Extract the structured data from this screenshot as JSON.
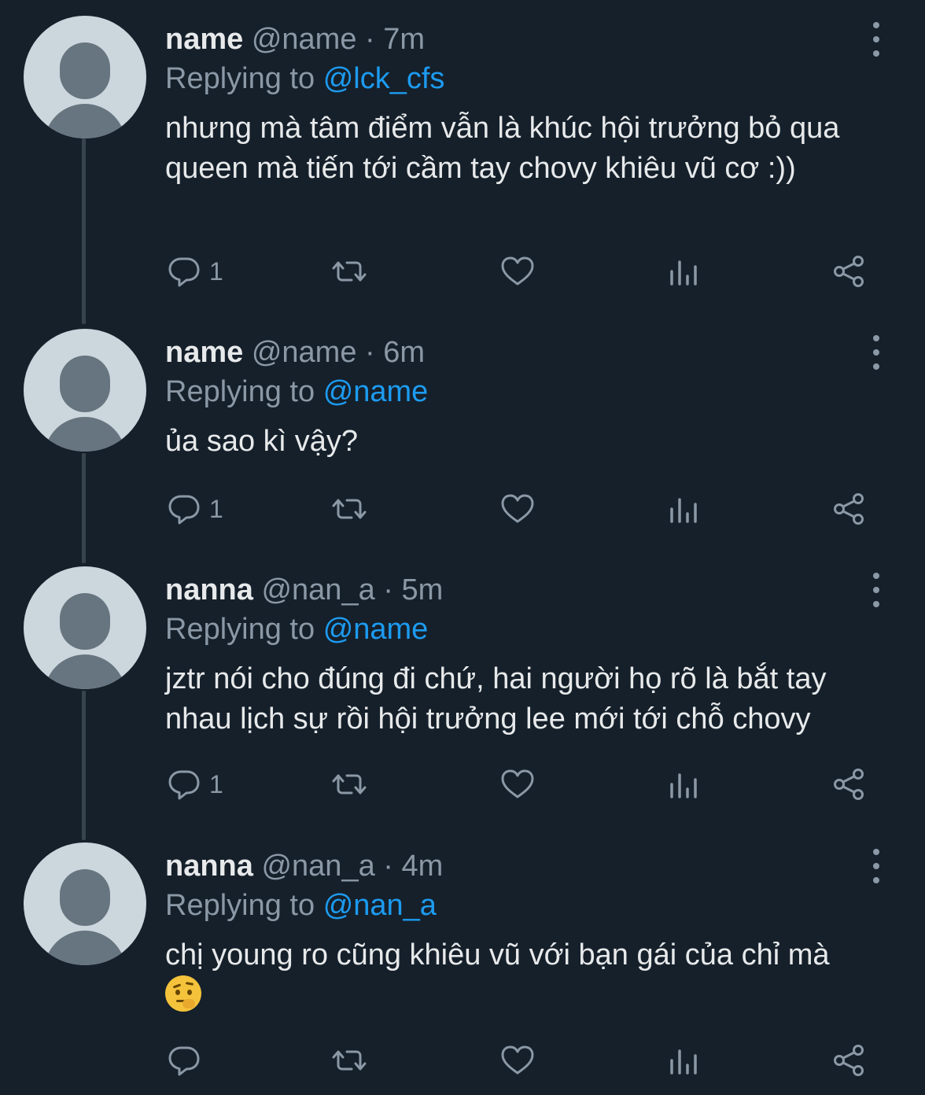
{
  "theme": {
    "background": "#15202b",
    "text": "#e7e9ea",
    "secondary": "#8b98a5",
    "accent": "#1d9bf0",
    "thread_line": "#38444d"
  },
  "tweets": [
    {
      "name": "name",
      "handle": "@name",
      "separator": "·",
      "time": "7m",
      "replying_prefix": "Replying to",
      "replying_to": "@lck_cfs",
      "text": "nhưng mà tâm điểm vẫn là khúc hội trưởng bỏ qua queen mà tiến tới cầm tay chovy khiêu vũ cơ :))",
      "reply_count": "1",
      "emoji": ""
    },
    {
      "name": "name",
      "handle": "@name",
      "separator": "·",
      "time": "6m",
      "replying_prefix": "Replying to",
      "replying_to": "@name",
      "text": "ủa sao kì vậy?",
      "reply_count": "1",
      "emoji": ""
    },
    {
      "name": "nanna",
      "handle": "@nan_a",
      "separator": "·",
      "time": "5m",
      "replying_prefix": "Replying to",
      "replying_to": "@name",
      "text": "jztr nói cho đúng đi chứ, hai người họ rõ là bắt tay nhau lịch sự rồi hội trưởng lee mới tới chỗ chovy",
      "reply_count": "1",
      "emoji": ""
    },
    {
      "name": "nanna",
      "handle": "@nan_a",
      "separator": "·",
      "time": "4m",
      "replying_prefix": "Replying to",
      "replying_to": "@nan_a",
      "text": "chị young ro cũng khiêu vũ với bạn gái của chỉ mà",
      "reply_count": "",
      "emoji": "face-with-raised-eyebrow"
    }
  ],
  "icons": {
    "reply": "reply-icon",
    "retweet": "retweet-icon",
    "like": "heart-icon",
    "views": "analytics-icon",
    "share": "share-icon",
    "more": "more-vertical-icon"
  }
}
